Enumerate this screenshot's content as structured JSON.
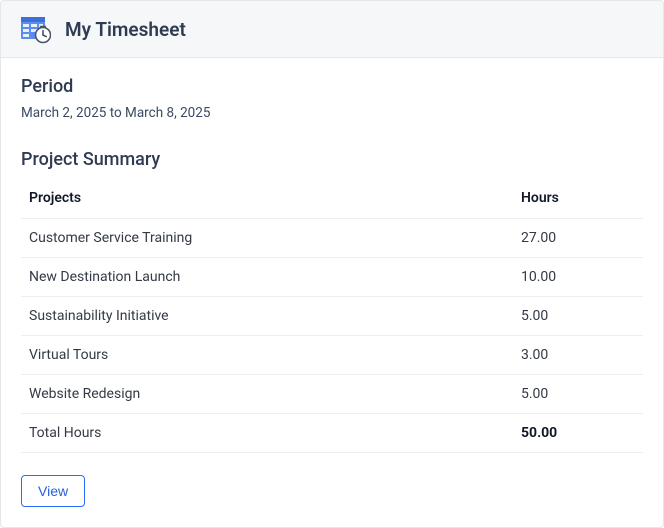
{
  "header": {
    "title": "My Timesheet"
  },
  "period": {
    "label": "Period",
    "value": "March 2, 2025 to March 8, 2025"
  },
  "summary": {
    "title": "Project Summary",
    "columns": {
      "projects": "Projects",
      "hours": "Hours"
    },
    "rows": [
      {
        "project": "Customer Service Training",
        "hours": "27.00"
      },
      {
        "project": "New Destination Launch",
        "hours": "10.00"
      },
      {
        "project": "Sustainability Initiative",
        "hours": "5.00"
      },
      {
        "project": "Virtual Tours",
        "hours": "3.00"
      },
      {
        "project": "Website Redesign",
        "hours": "5.00"
      }
    ],
    "total": {
      "label": "Total Hours",
      "hours": "50.00"
    }
  },
  "actions": {
    "view": "View"
  }
}
